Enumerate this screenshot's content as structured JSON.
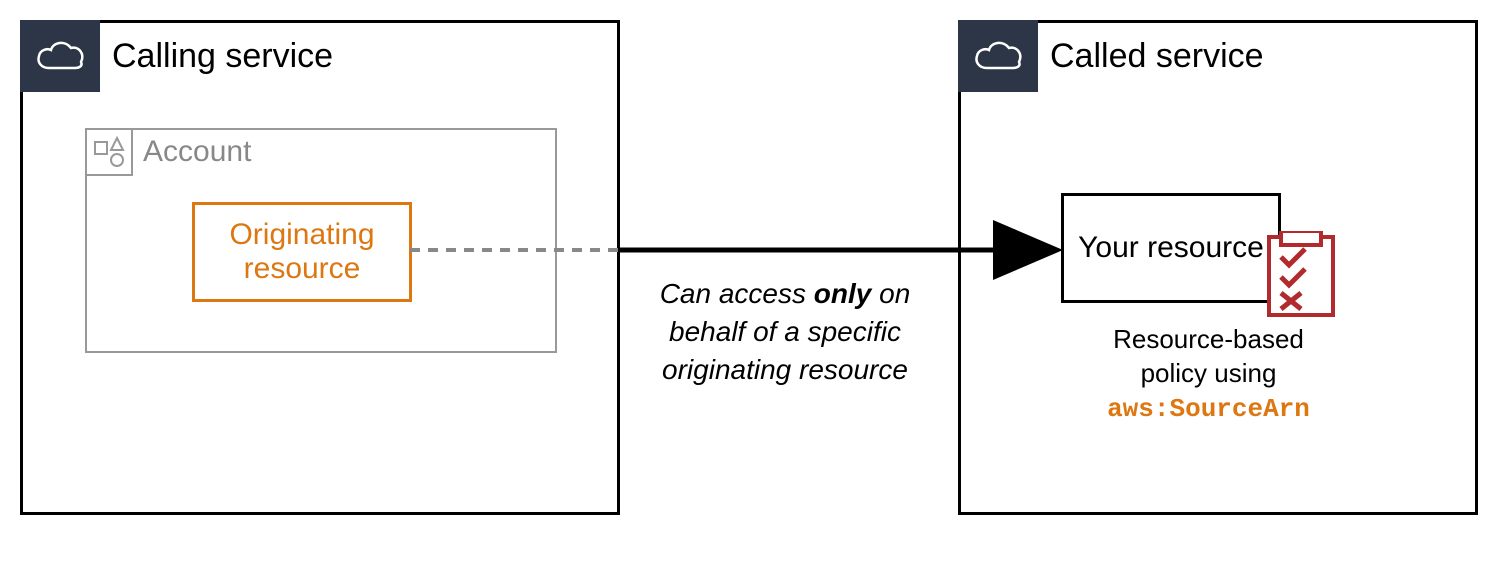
{
  "calling": {
    "title": "Calling service",
    "account_label": "Account",
    "originating_label": "Originating resource"
  },
  "called": {
    "title": "Called service",
    "resource_label": "Your resource",
    "policy_line1": "Resource-based",
    "policy_line2": "policy using",
    "policy_code": "aws:SourceArn"
  },
  "arrow": {
    "pre": "Can access ",
    "only": "only",
    "rest": " on behalf of a specific originating resource"
  }
}
